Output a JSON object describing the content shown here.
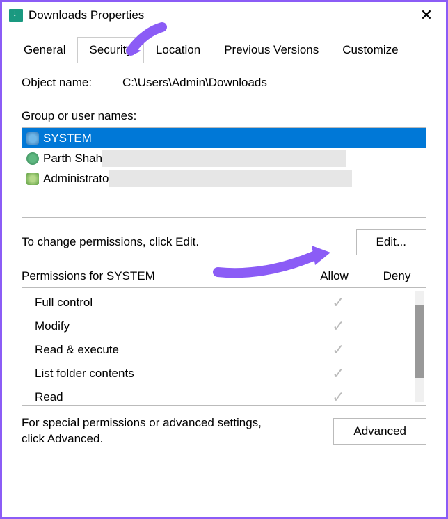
{
  "window": {
    "title": "Downloads Properties"
  },
  "tabs": {
    "items": [
      {
        "label": "General"
      },
      {
        "label": "Security"
      },
      {
        "label": "Location"
      },
      {
        "label": "Previous Versions"
      },
      {
        "label": "Customize"
      }
    ],
    "active_index": 1
  },
  "object": {
    "label": "Object name:",
    "value": "C:\\Users\\Admin\\Downloads"
  },
  "groups": {
    "label": "Group or user names:",
    "items": [
      {
        "name": "SYSTEM",
        "icon": "group",
        "selected": true
      },
      {
        "name": "Parth Shah",
        "icon": "user",
        "selected": false
      },
      {
        "name": "Administrators",
        "icon": "admin",
        "selected": false,
        "display": "Administrato"
      }
    ]
  },
  "edit": {
    "text": "To change permissions, click Edit.",
    "button_label": "Edit..."
  },
  "permissions": {
    "title": "Permissions for SYSTEM",
    "allow_label": "Allow",
    "deny_label": "Deny",
    "rows": [
      {
        "name": "Full control",
        "allow": true,
        "deny": false
      },
      {
        "name": "Modify",
        "allow": true,
        "deny": false
      },
      {
        "name": "Read & execute",
        "allow": true,
        "deny": false
      },
      {
        "name": "List folder contents",
        "allow": true,
        "deny": false
      },
      {
        "name": "Read",
        "allow": true,
        "deny": false
      }
    ]
  },
  "advanced": {
    "text": "For special permissions or advanced settings, click Advanced.",
    "button_label": "Advanced"
  },
  "annotation_color": "#8b5cf6"
}
